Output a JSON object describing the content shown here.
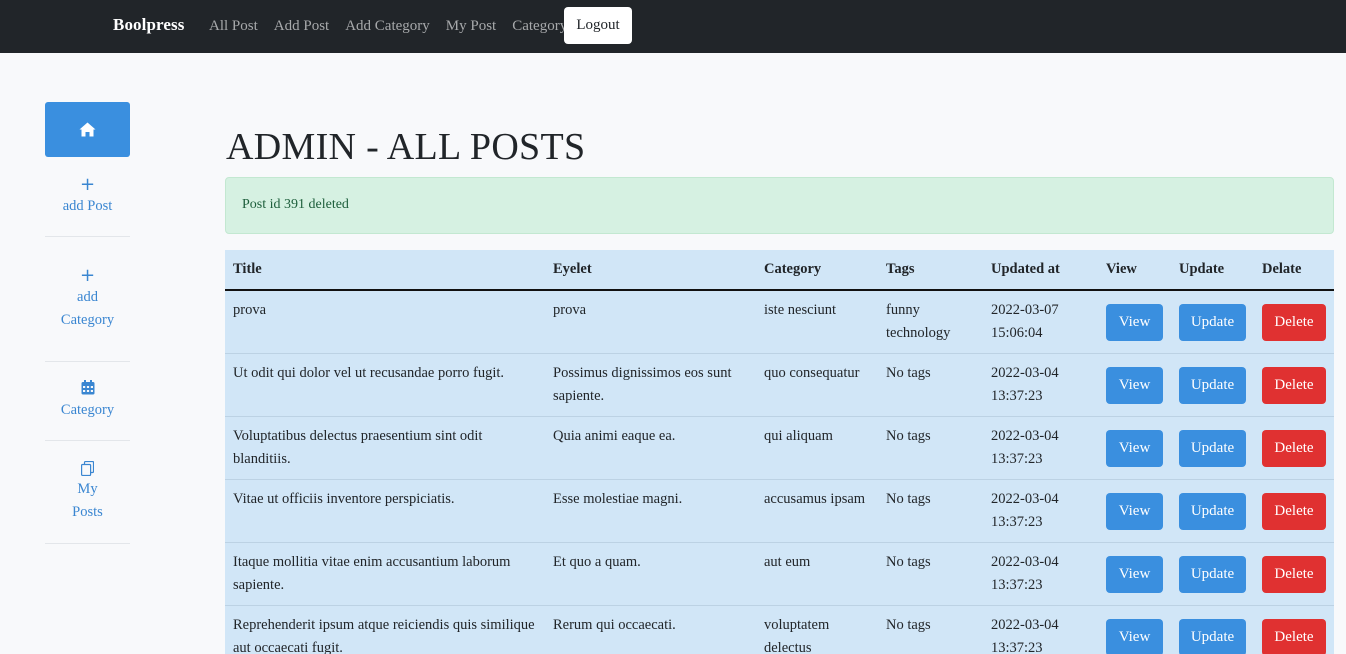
{
  "navbar": {
    "brand": "Boolpress",
    "links": [
      "All Post",
      "Add Post",
      "Add Category",
      "My Post",
      "Category"
    ],
    "logout_label": "Logout"
  },
  "sidebar": {
    "home_icon": "home-icon",
    "items": [
      {
        "icon": "plus-icon",
        "glyph": "+",
        "label_lines": [
          "add Post"
        ]
      },
      {
        "icon": "plus-icon",
        "glyph": "+",
        "label_lines": [
          "add",
          "Category"
        ]
      },
      {
        "icon": "calendar-icon",
        "glyph": "▦",
        "label_lines": [
          "Category"
        ]
      },
      {
        "icon": "copy-icon",
        "glyph": "⧉",
        "label_lines": [
          "My",
          "Posts"
        ]
      }
    ]
  },
  "main": {
    "title": "ADMIN - ALL POSTS",
    "alert": "Post id 391 deleted"
  },
  "table": {
    "headers": [
      "Title",
      "Eyelet",
      "Category",
      "Tags",
      "Updated at",
      "View",
      "Update",
      "Delate"
    ],
    "view_label": "View",
    "update_label": "Update",
    "delete_label": "Delete",
    "rows": [
      {
        "title": "prova",
        "eyelet": "prova",
        "category": "iste nesciunt",
        "tags": [
          "funny",
          "technology"
        ],
        "date": "2022-03-07",
        "time": "15:06:04"
      },
      {
        "title": "Ut odit qui dolor vel ut recusandae porro fugit.",
        "eyelet": "Possimus dignissimos eos sunt sapiente.",
        "category": "quo consequatur",
        "tags": [
          "No tags"
        ],
        "date": "2022-03-04",
        "time": "13:37:23"
      },
      {
        "title": "Voluptatibus delectus praesentium sint odit blanditiis.",
        "eyelet": "Quia animi eaque ea.",
        "category": "qui aliquam",
        "tags": [
          "No tags"
        ],
        "date": "2022-03-04",
        "time": "13:37:23"
      },
      {
        "title": "Vitae ut officiis inventore perspiciatis.",
        "eyelet": "Esse molestiae magni.",
        "category": "accusamus ipsam",
        "tags": [
          "No tags"
        ],
        "date": "2022-03-04",
        "time": "13:37:23"
      },
      {
        "title": "Itaque mollitia vitae enim accusantium laborum sapiente.",
        "eyelet": "Et quo a quam.",
        "category": "aut eum",
        "tags": [
          "No tags"
        ],
        "date": "2022-03-04",
        "time": "13:37:23"
      },
      {
        "title": "Reprehenderit ipsum atque reiciendis quis similique aut occaecati fugit.",
        "eyelet": "Rerum qui occaecati.",
        "category": "voluptatem delectus",
        "tags": [
          "No tags"
        ],
        "date": "2022-03-04",
        "time": "13:37:23"
      }
    ]
  },
  "colors": {
    "navbar_bg": "#212529",
    "primary": "#3a8fdf",
    "danger": "#e03131",
    "alert_bg": "#d6f1e2",
    "table_bg": "#d1e6f7"
  }
}
